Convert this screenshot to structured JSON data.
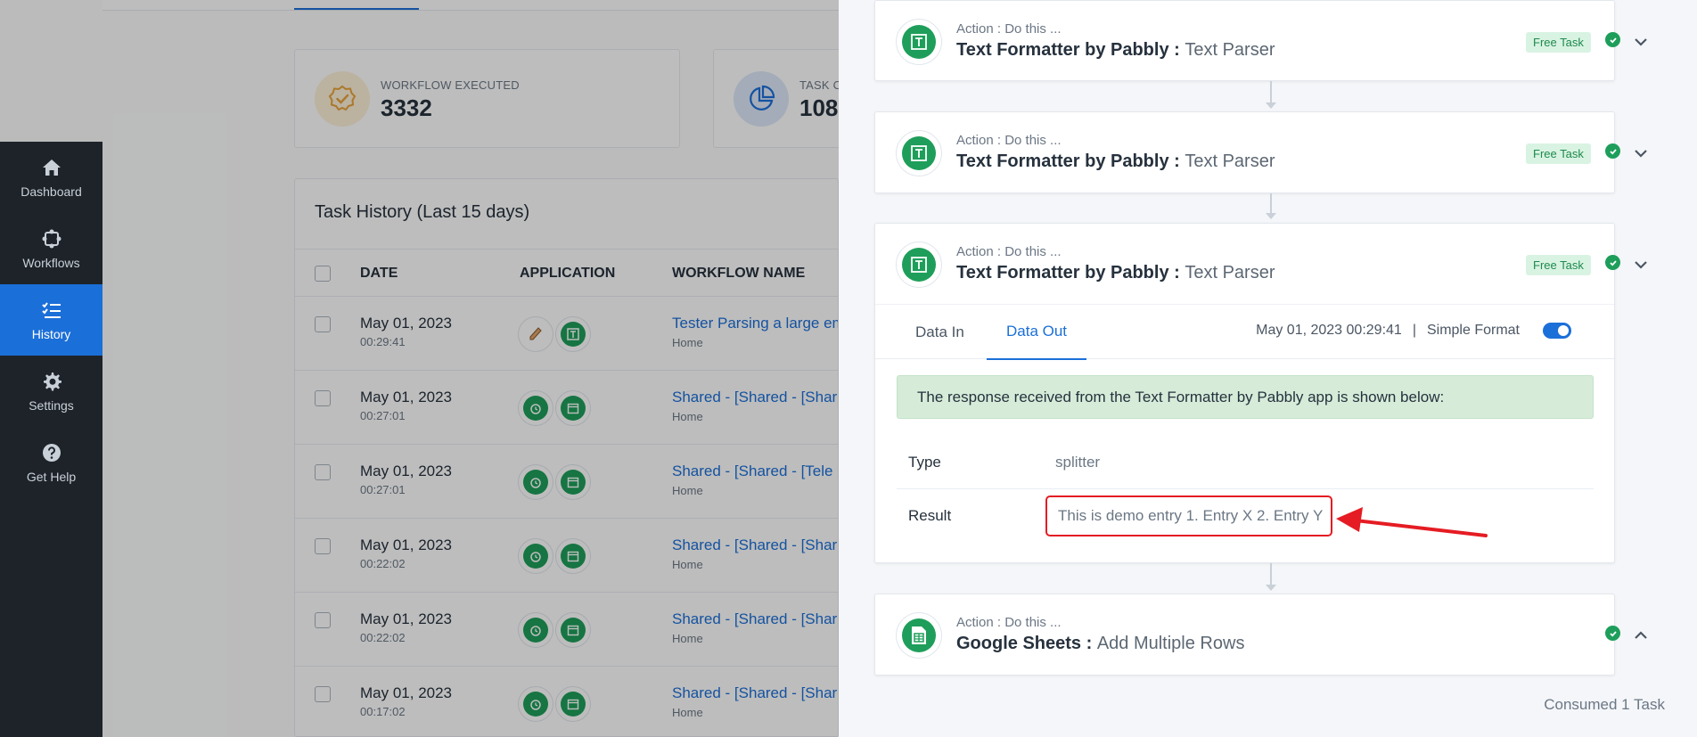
{
  "colors": {
    "accent": "#1b6fd8",
    "success": "#1e9e5a",
    "sidebar_bg": "#1d2329",
    "highlight_red": "#e51c23"
  },
  "sidebar": {
    "items": [
      {
        "label": "Dashboard",
        "icon": "home-icon"
      },
      {
        "label": "Workflows",
        "icon": "workflow-icon"
      },
      {
        "label": "History",
        "icon": "history-icon",
        "active": true
      },
      {
        "label": "Settings",
        "icon": "gear-icon"
      },
      {
        "label": "Get Help",
        "icon": "help-icon"
      }
    ]
  },
  "stats": [
    {
      "label": "WORKFLOW EXECUTED",
      "value": "3332",
      "icon": "badge-check-icon"
    },
    {
      "label": "TASK C",
      "value": "108",
      "icon": "pie-chart-icon"
    }
  ],
  "history": {
    "title": "Task History (Last 15 days)",
    "columns": [
      "DATE",
      "APPLICATION",
      "WORKFLOW NAME"
    ],
    "rows": [
      {
        "date": "May 01, 2023",
        "time": "00:29:41",
        "workflow": "Tester Parsing a large em",
        "folder": "Home"
      },
      {
        "date": "May 01, 2023",
        "time": "00:27:01",
        "workflow": "Shared - [Shared - [Share",
        "folder": "Home"
      },
      {
        "date": "May 01, 2023",
        "time": "00:27:01",
        "workflow": "Shared - [Shared - [Tele F",
        "folder": "Home"
      },
      {
        "date": "May 01, 2023",
        "time": "00:22:02",
        "workflow": "Shared - [Shared - [Share",
        "folder": "Home"
      },
      {
        "date": "May 01, 2023",
        "time": "00:22:02",
        "workflow": "Shared - [Shared - [Share",
        "folder": "Home"
      },
      {
        "date": "May 01, 2023",
        "time": "00:17:02",
        "workflow": "Shared - [Shared - [Share",
        "folder": "Home"
      }
    ]
  },
  "steps": [
    {
      "kicker": "Action : Do this ...",
      "app": "Text Formatter by Pabbly",
      "separator": " : ",
      "event": "Text Parser",
      "badge": "Free Task"
    },
    {
      "kicker": "Action : Do this ...",
      "app": "Text Formatter by Pabbly",
      "separator": " : ",
      "event": "Text Parser",
      "badge": "Free Task"
    },
    {
      "kicker": "Action : Do this ...",
      "app": "Text Formatter by Pabbly",
      "separator": " : ",
      "event": "Text Parser",
      "badge": "Free Task"
    },
    {
      "kicker": "Action : Do this ...",
      "app": "Google Sheets",
      "separator": " : ",
      "event": "Add Multiple Rows"
    }
  ],
  "detail": {
    "tabs": [
      "Data In",
      "Data Out"
    ],
    "timestamp": "May 01, 2023 00:29:41",
    "divider": "|",
    "format_label": "Simple Format",
    "alert": "The response received from the Text Formatter by Pabbly app is shown below:",
    "fields": [
      {
        "key": "Type",
        "value": "splitter"
      },
      {
        "key": "Result",
        "value": "This is demo entry 1. Entry X 2. Entry Y"
      }
    ]
  },
  "footer": {
    "consumed": "Consumed 1 Task"
  }
}
